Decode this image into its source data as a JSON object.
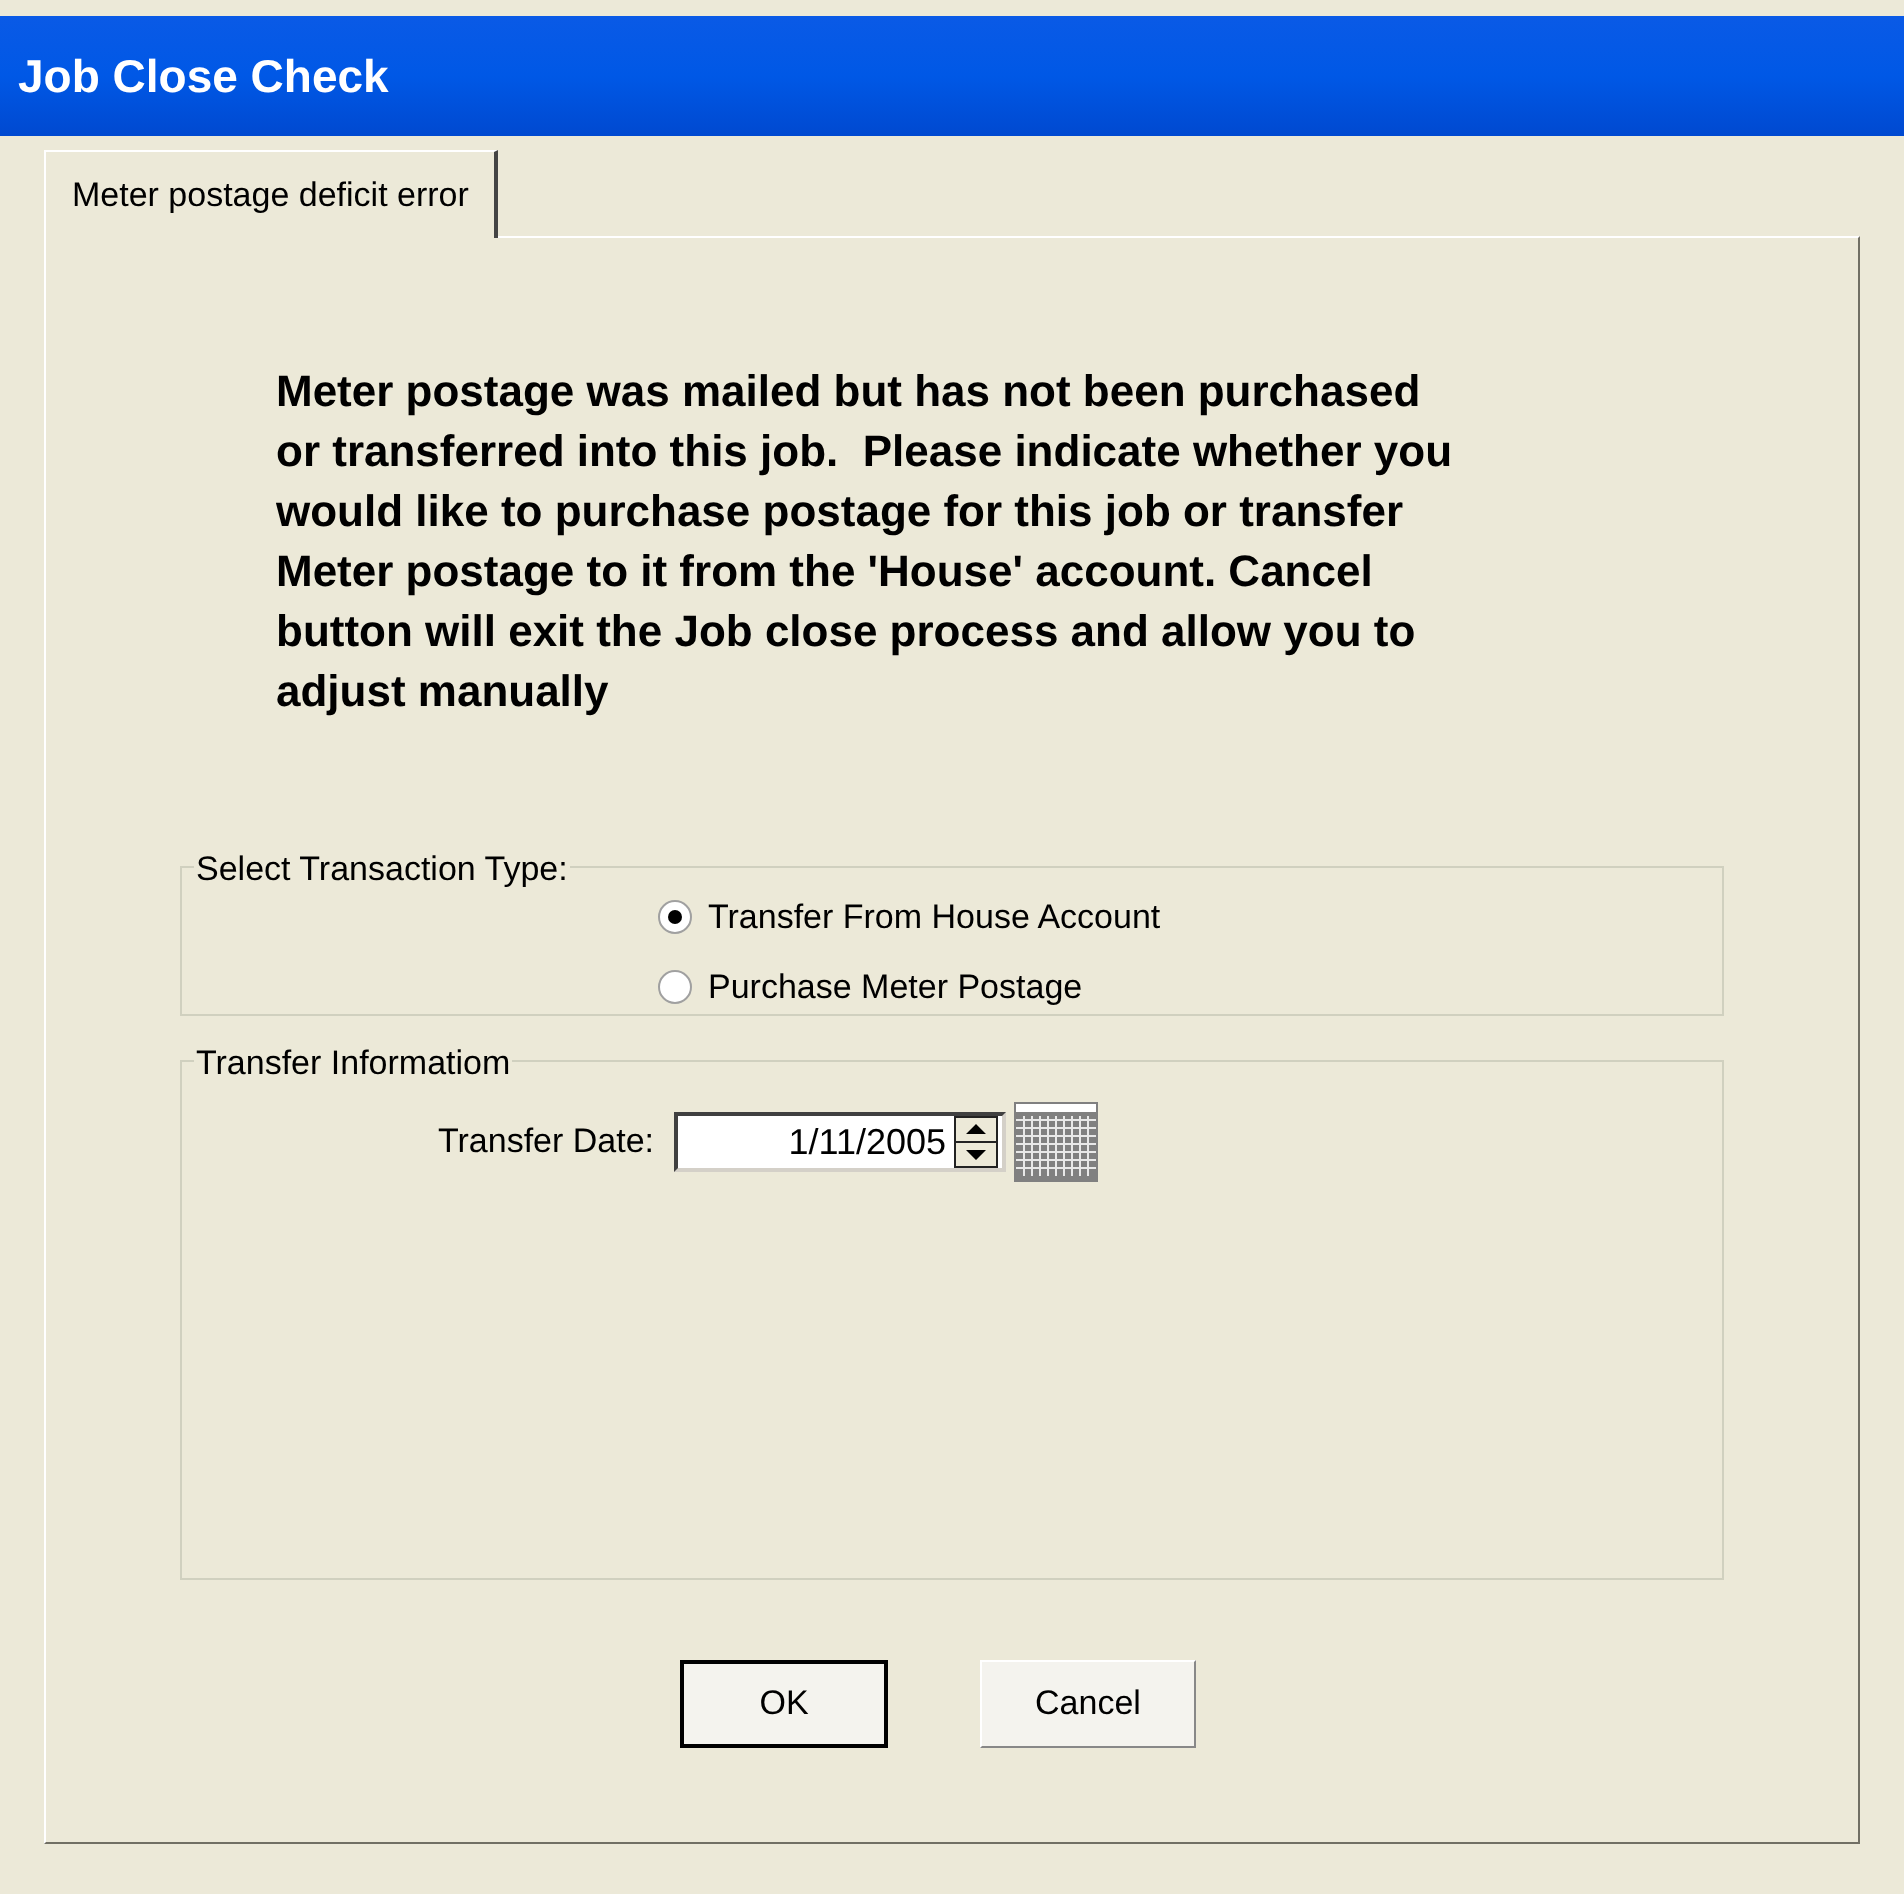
{
  "window": {
    "title": "Job Close Check"
  },
  "tabs": [
    {
      "label": "Meter postage deficit error",
      "selected": true
    }
  ],
  "message": "Meter postage was mailed but has not been purchased or transferred into this job.  Please indicate whether you would like to purchase postage for this job or transfer Meter postage to it from the 'House' account. Cancel button will exit the Job close process and allow you to adjust manually",
  "transaction_type": {
    "label": "Select Transaction Type:",
    "options": [
      {
        "label": "Transfer From House Account",
        "selected": true
      },
      {
        "label": "Purchase Meter Postage",
        "selected": false
      }
    ]
  },
  "transfer_information": {
    "label": "Transfer Informatiom",
    "date_label": "Transfer Date:",
    "date_value": "1/11/2005"
  },
  "buttons": [
    {
      "label": "OK",
      "default": true
    },
    {
      "label": "Cancel",
      "default": false
    }
  ]
}
